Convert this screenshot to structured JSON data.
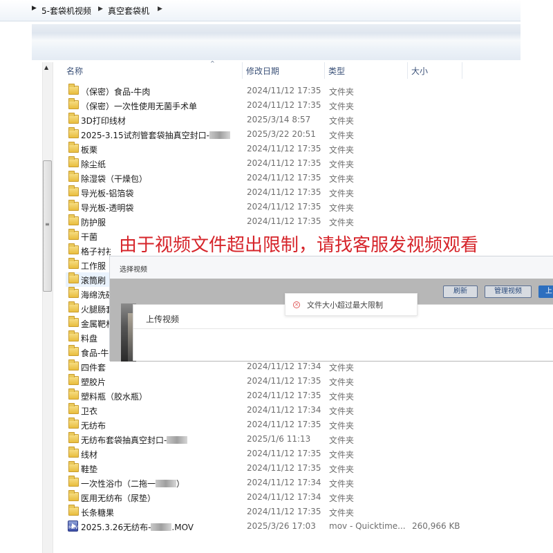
{
  "breadcrumb": [
    "5-套袋机视频",
    "真空套袋机"
  ],
  "columns": {
    "name": "名称",
    "date": "修改日期",
    "type": "类型",
    "size": "大小"
  },
  "rows": [
    {
      "name": "（保密）食品-牛肉",
      "date": "2024/11/12 17:35",
      "type": "文件夹",
      "size": "",
      "icon": "folder-icon"
    },
    {
      "name": "（保密）一次性使用无菌手术单",
      "date": "2024/11/12 17:35",
      "type": "文件夹",
      "size": "",
      "icon": "folder-icon"
    },
    {
      "name": "3D打印线材",
      "date": "2025/3/14 8:57",
      "type": "文件夹",
      "size": "",
      "icon": "folder-icon"
    },
    {
      "name": "2025-3.15试剂管套袋抽真空封口-",
      "date": "2025/3/22 20:51",
      "type": "文件夹",
      "size": "",
      "icon": "folder-icon",
      "redacted": true
    },
    {
      "name": "板栗",
      "date": "2024/11/12 17:35",
      "type": "文件夹",
      "size": "",
      "icon": "folder-icon"
    },
    {
      "name": "除尘纸",
      "date": "2024/11/12 17:35",
      "type": "文件夹",
      "size": "",
      "icon": "folder-icon"
    },
    {
      "name": "除湿袋（干燥包）",
      "date": "2024/11/12 17:35",
      "type": "文件夹",
      "size": "",
      "icon": "folder-icon"
    },
    {
      "name": "导光板-铝箔袋",
      "date": "2024/11/12 17:35",
      "type": "文件夹",
      "size": "",
      "icon": "folder-icon"
    },
    {
      "name": "导光板-透明袋",
      "date": "2024/11/12 17:35",
      "type": "文件夹",
      "size": "",
      "icon": "folder-icon"
    },
    {
      "name": "防护服",
      "date": "2024/11/12 17:35",
      "type": "文件夹",
      "size": "",
      "icon": "folder-icon"
    },
    {
      "name": "干菌",
      "date": "",
      "type": "",
      "size": "",
      "icon": "folder-icon"
    },
    {
      "name": "格子衬衫",
      "date": "",
      "type": "",
      "size": "",
      "icon": "folder-icon"
    },
    {
      "name": "工作服",
      "date": "",
      "type": "",
      "size": "",
      "icon": "folder-icon"
    },
    {
      "name": "滚筒刷",
      "date": "",
      "type": "",
      "size": "",
      "icon": "folder-icon"
    },
    {
      "name": "海绵洗碗",
      "date": "",
      "type": "",
      "size": "",
      "icon": "folder-icon"
    },
    {
      "name": "火腿肠套",
      "date": "",
      "type": "",
      "size": "",
      "icon": "folder-icon"
    },
    {
      "name": "金属靶材",
      "date": "",
      "type": "",
      "size": "",
      "icon": "folder-icon"
    },
    {
      "name": "料盘",
      "date": "",
      "type": "",
      "size": "",
      "icon": "folder-icon"
    },
    {
      "name": "食品-牛",
      "date": "",
      "type": "",
      "size": "",
      "icon": "folder-icon"
    },
    {
      "name": "四件套",
      "date": "2024/11/12 17:34",
      "type": "文件夹",
      "size": "",
      "icon": "folder-icon"
    },
    {
      "name": "塑胶片",
      "date": "2024/11/12 17:35",
      "type": "文件夹",
      "size": "",
      "icon": "folder-icon"
    },
    {
      "name": "塑料瓶（胶水瓶）",
      "date": "2024/11/12 17:35",
      "type": "文件夹",
      "size": "",
      "icon": "folder-icon"
    },
    {
      "name": "卫衣",
      "date": "2024/11/12 17:34",
      "type": "文件夹",
      "size": "",
      "icon": "folder-icon"
    },
    {
      "name": "无纺布",
      "date": "2024/11/12 17:35",
      "type": "文件夹",
      "size": "",
      "icon": "folder-icon"
    },
    {
      "name": "无纺布套袋抽真空封口-",
      "date": "2025/1/6 11:13",
      "type": "文件夹",
      "size": "",
      "icon": "folder-icon",
      "redacted": true
    },
    {
      "name": "线材",
      "date": "2024/11/12 17:35",
      "type": "文件夹",
      "size": "",
      "icon": "folder-icon"
    },
    {
      "name": "鞋垫",
      "date": "2024/11/12 17:35",
      "type": "文件夹",
      "size": "",
      "icon": "folder-icon"
    },
    {
      "name": "一次性浴巾（二拖一",
      "name_suffix": "）",
      "date": "2024/11/12 17:34",
      "type": "文件夹",
      "size": "",
      "icon": "folder-icon",
      "redacted": true
    },
    {
      "name": "医用无纺布（尿垫）",
      "date": "2024/11/12 17:34",
      "type": "文件夹",
      "size": "",
      "icon": "folder-icon"
    },
    {
      "name": "长条糖果",
      "date": "2024/11/12 17:35",
      "type": "文件夹",
      "size": "",
      "icon": "folder-icon"
    },
    {
      "name": "2025.3.26无纺布-",
      "name_suffix": ".MOV",
      "date": "2025/3/26 17:03",
      "type": "mov - Quicktime...",
      "size": "260,966 KB",
      "icon": "video-file-icon",
      "redacted": true
    }
  ],
  "overlay": {
    "banner": "由于视频文件超出限制，请找客服发视频观看",
    "dialog_title": "选择视频",
    "buttons": [
      "刷新",
      "管理视频",
      "上"
    ],
    "upload_title": "上传视频",
    "toast": "文件大小超过最大限制"
  },
  "colors": {
    "banner_red": "#d6242a",
    "header_text": "#3b5178",
    "folder_yellow": "#e9bd3e"
  }
}
